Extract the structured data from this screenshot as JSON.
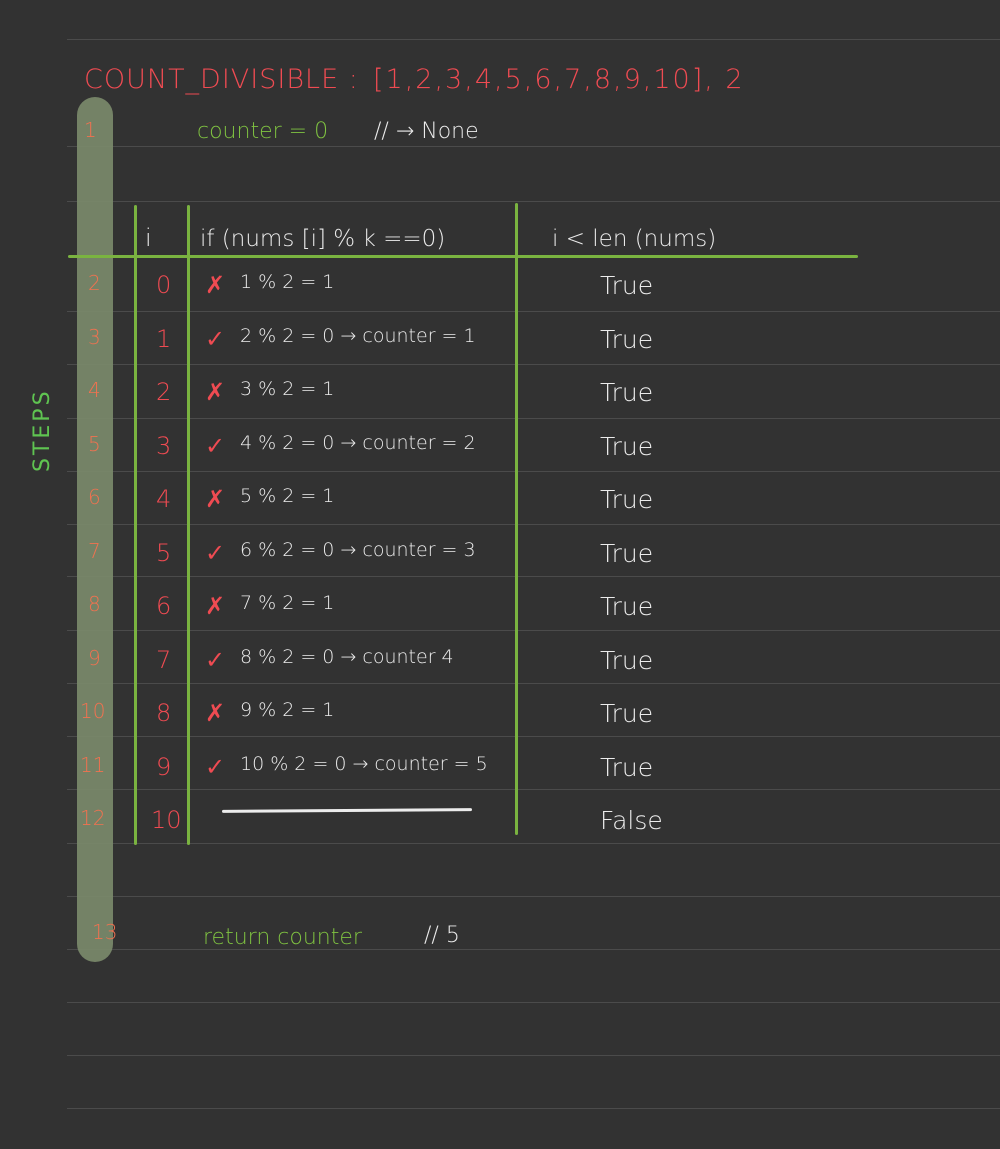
{
  "title": {
    "name": "COUNT_DIVISIBLE :",
    "args": "[1,2,3,4,5,6,7,8,9,10], 2"
  },
  "side_label": "STEPS",
  "init": {
    "step": "1",
    "code": "counter = 0",
    "comment": "// → None"
  },
  "table": {
    "headers": {
      "i": "i",
      "condition": "if (nums [i] % k ==0)",
      "loop": "i < len (nums)"
    },
    "rows": [
      {
        "step": "2",
        "i": "0",
        "mark": "✗",
        "expr": "1 % 2 = 1",
        "loop": "True"
      },
      {
        "step": "3",
        "i": "1",
        "mark": "✓",
        "expr": "2 % 2 = 0 → counter = 1",
        "loop": "True"
      },
      {
        "step": "4",
        "i": "2",
        "mark": "✗",
        "expr": "3 % 2 = 1",
        "loop": "True"
      },
      {
        "step": "5",
        "i": "3",
        "mark": "✓",
        "expr": "4 % 2 = 0 → counter = 2",
        "loop": "True"
      },
      {
        "step": "6",
        "i": "4",
        "mark": "✗",
        "expr": "5 % 2 = 1",
        "loop": "True"
      },
      {
        "step": "7",
        "i": "5",
        "mark": "✓",
        "expr": "6 % 2 = 0 → counter = 3",
        "loop": "True"
      },
      {
        "step": "8",
        "i": "6",
        "mark": "✗",
        "expr": "7 % 2 = 1",
        "loop": "True"
      },
      {
        "step": "9",
        "i": "7",
        "mark": "✓",
        "expr": "8 % 2 = 0 → counter 4",
        "loop": "True"
      },
      {
        "step": "10",
        "i": "8",
        "mark": "✗",
        "expr": "9 % 2 = 1",
        "loop": "True"
      },
      {
        "step": "11",
        "i": "9",
        "mark": "✓",
        "expr": "10 % 2 = 0 → counter = 5",
        "loop": "True"
      },
      {
        "step": "12",
        "i": "10",
        "mark": "",
        "expr": "",
        "loop": "False"
      }
    ]
  },
  "final": {
    "step": "13",
    "code": "return counter",
    "comment": "// 5"
  },
  "colors": {
    "background": "#323232",
    "red": "#ef4b52",
    "green": "#7fc241",
    "white": "#ececec",
    "steps_bar": "#7b8b6c"
  }
}
